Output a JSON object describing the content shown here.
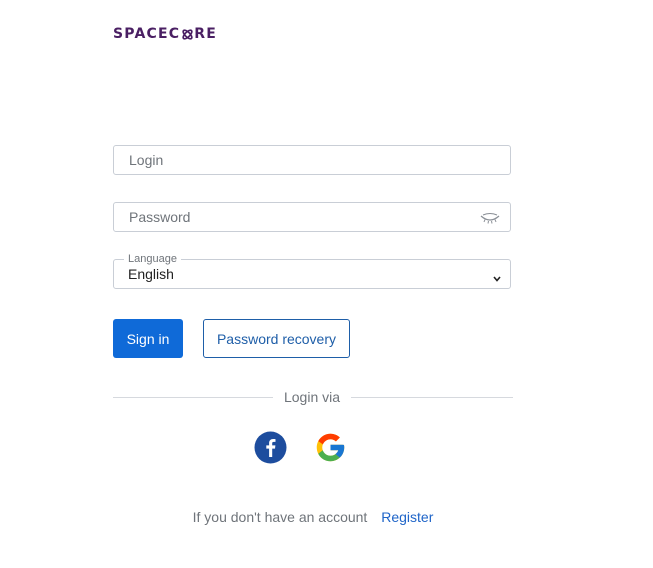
{
  "brand": {
    "prefix": "SPACEC",
    "suffix": "RE",
    "color": "#4a1f63"
  },
  "form": {
    "login": {
      "placeholder": "Login",
      "value": ""
    },
    "password": {
      "placeholder": "Password",
      "value": "",
      "toggle_icon": "eye-closed-icon"
    },
    "language": {
      "label": "Language",
      "selected": "English"
    }
  },
  "buttons": {
    "sign_in": "Sign in",
    "password_recovery": "Password recovery"
  },
  "login_via": {
    "label": "Login via",
    "providers": [
      "facebook-icon",
      "google-icon"
    ]
  },
  "register": {
    "prompt": "If you don't have an account",
    "link": "Register"
  },
  "colors": {
    "primary": "#0f6ad8",
    "link": "#1e64c8",
    "facebook": "#1d4d9e"
  }
}
